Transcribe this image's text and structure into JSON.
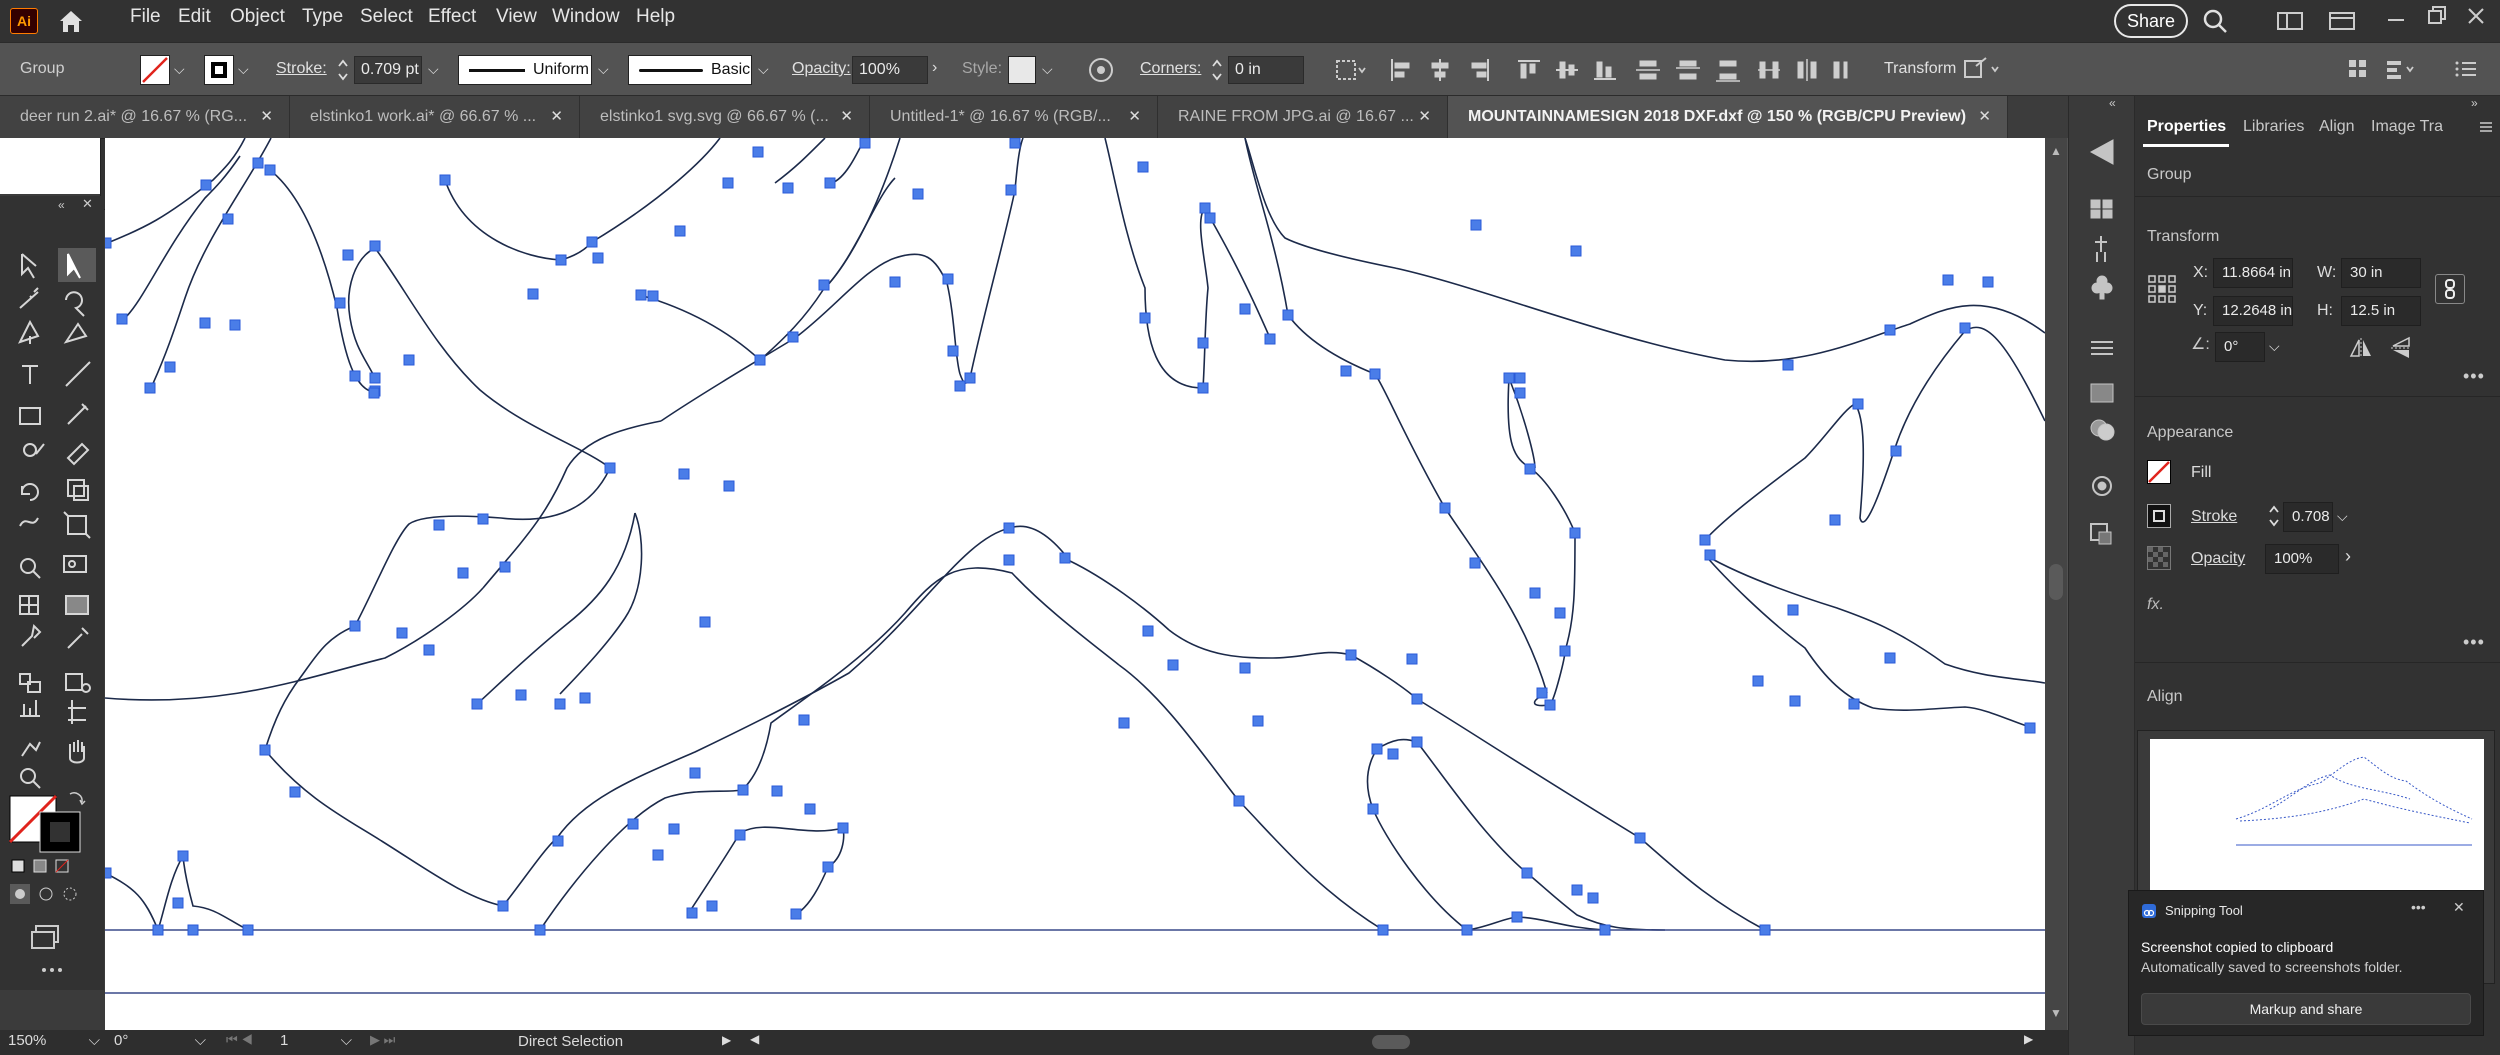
{
  "app": {
    "logo": "Ai"
  },
  "menu": [
    "File",
    "Edit",
    "Object",
    "Type",
    "Select",
    "Effect",
    "View",
    "Window",
    "Help"
  ],
  "share_label": "Share",
  "control_bar": {
    "selection": "Group",
    "stroke_label": "Stroke:",
    "stroke_value": "0.709 pt",
    "stroke_profile": "Uniform",
    "brush": "Basic",
    "opacity_label": "Opacity:",
    "opacity_value": "100%",
    "style_label": "Style:",
    "corners_label": "Corners:",
    "corners_value": "0 in",
    "transform_label": "Transform"
  },
  "tabs": [
    {
      "label": "deer run 2.ai* @ 16.67 % (RG..."
    },
    {
      "label": "elstinko1 work.ai* @ 66.67 % ..."
    },
    {
      "label": "elstinko1 svg.svg @ 66.67 % (..."
    },
    {
      "label": "Untitled-1* @ 16.67 % (RGB/..."
    },
    {
      "label": "RAINE FROM JPG.ai @ 16.67 ..."
    },
    {
      "label": "MOUNTAINNAMESIGN 2018 DXF.dxf @ 150 % (RGB/CPU Preview)"
    }
  ],
  "status": {
    "zoom": "150%",
    "rotation": "0°",
    "artboard": "1",
    "tool": "Direct Selection"
  },
  "properties": {
    "tabs": [
      "Properties",
      "Libraries",
      "Align",
      "Image Tra"
    ],
    "selection": "Group",
    "transform_title": "Transform",
    "x_label": "X:",
    "x_value": "11.8664 in",
    "y_label": "Y:",
    "y_value": "12.2648 in",
    "w_label": "W:",
    "w_value": "30 in",
    "h_label": "H:",
    "h_value": "12.5 in",
    "angle_value": "0°",
    "appearance_title": "Appearance",
    "fill_label": "Fill",
    "stroke_label": "Stroke",
    "stroke_value": "0.708",
    "opacity_label": "Opacity",
    "opacity_value": "100%",
    "fx_label": "fx.",
    "align_title": "Align"
  },
  "toast": {
    "app": "Snipping Tool",
    "title": "Screenshot copied to clipboard",
    "body": "Automatically saved to screenshots folder.",
    "action": "Markup and share"
  },
  "colors": {
    "anchor": "#4a7de8",
    "path": "#1c2a4a",
    "accent": "#ff4a1f"
  }
}
